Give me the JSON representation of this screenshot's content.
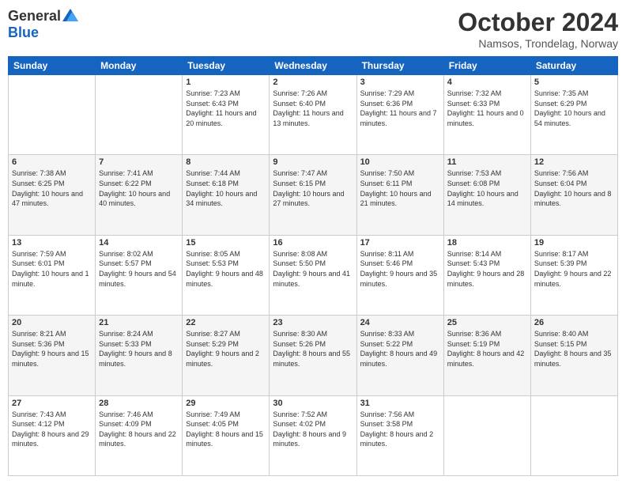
{
  "logo": {
    "general": "General",
    "blue": "Blue"
  },
  "header": {
    "month": "October 2024",
    "location": "Namsos, Trondelag, Norway"
  },
  "weekdays": [
    "Sunday",
    "Monday",
    "Tuesday",
    "Wednesday",
    "Thursday",
    "Friday",
    "Saturday"
  ],
  "weeks": [
    [
      {
        "day": "",
        "sunrise": "",
        "sunset": "",
        "daylight": ""
      },
      {
        "day": "",
        "sunrise": "",
        "sunset": "",
        "daylight": ""
      },
      {
        "day": "1",
        "sunrise": "Sunrise: 7:23 AM",
        "sunset": "Sunset: 6:43 PM",
        "daylight": "Daylight: 11 hours and 20 minutes."
      },
      {
        "day": "2",
        "sunrise": "Sunrise: 7:26 AM",
        "sunset": "Sunset: 6:40 PM",
        "daylight": "Daylight: 11 hours and 13 minutes."
      },
      {
        "day": "3",
        "sunrise": "Sunrise: 7:29 AM",
        "sunset": "Sunset: 6:36 PM",
        "daylight": "Daylight: 11 hours and 7 minutes."
      },
      {
        "day": "4",
        "sunrise": "Sunrise: 7:32 AM",
        "sunset": "Sunset: 6:33 PM",
        "daylight": "Daylight: 11 hours and 0 minutes."
      },
      {
        "day": "5",
        "sunrise": "Sunrise: 7:35 AM",
        "sunset": "Sunset: 6:29 PM",
        "daylight": "Daylight: 10 hours and 54 minutes."
      }
    ],
    [
      {
        "day": "6",
        "sunrise": "Sunrise: 7:38 AM",
        "sunset": "Sunset: 6:25 PM",
        "daylight": "Daylight: 10 hours and 47 minutes."
      },
      {
        "day": "7",
        "sunrise": "Sunrise: 7:41 AM",
        "sunset": "Sunset: 6:22 PM",
        "daylight": "Daylight: 10 hours and 40 minutes."
      },
      {
        "day": "8",
        "sunrise": "Sunrise: 7:44 AM",
        "sunset": "Sunset: 6:18 PM",
        "daylight": "Daylight: 10 hours and 34 minutes."
      },
      {
        "day": "9",
        "sunrise": "Sunrise: 7:47 AM",
        "sunset": "Sunset: 6:15 PM",
        "daylight": "Daylight: 10 hours and 27 minutes."
      },
      {
        "day": "10",
        "sunrise": "Sunrise: 7:50 AM",
        "sunset": "Sunset: 6:11 PM",
        "daylight": "Daylight: 10 hours and 21 minutes."
      },
      {
        "day": "11",
        "sunrise": "Sunrise: 7:53 AM",
        "sunset": "Sunset: 6:08 PM",
        "daylight": "Daylight: 10 hours and 14 minutes."
      },
      {
        "day": "12",
        "sunrise": "Sunrise: 7:56 AM",
        "sunset": "Sunset: 6:04 PM",
        "daylight": "Daylight: 10 hours and 8 minutes."
      }
    ],
    [
      {
        "day": "13",
        "sunrise": "Sunrise: 7:59 AM",
        "sunset": "Sunset: 6:01 PM",
        "daylight": "Daylight: 10 hours and 1 minute."
      },
      {
        "day": "14",
        "sunrise": "Sunrise: 8:02 AM",
        "sunset": "Sunset: 5:57 PM",
        "daylight": "Daylight: 9 hours and 54 minutes."
      },
      {
        "day": "15",
        "sunrise": "Sunrise: 8:05 AM",
        "sunset": "Sunset: 5:53 PM",
        "daylight": "Daylight: 9 hours and 48 minutes."
      },
      {
        "day": "16",
        "sunrise": "Sunrise: 8:08 AM",
        "sunset": "Sunset: 5:50 PM",
        "daylight": "Daylight: 9 hours and 41 minutes."
      },
      {
        "day": "17",
        "sunrise": "Sunrise: 8:11 AM",
        "sunset": "Sunset: 5:46 PM",
        "daylight": "Daylight: 9 hours and 35 minutes."
      },
      {
        "day": "18",
        "sunrise": "Sunrise: 8:14 AM",
        "sunset": "Sunset: 5:43 PM",
        "daylight": "Daylight: 9 hours and 28 minutes."
      },
      {
        "day": "19",
        "sunrise": "Sunrise: 8:17 AM",
        "sunset": "Sunset: 5:39 PM",
        "daylight": "Daylight: 9 hours and 22 minutes."
      }
    ],
    [
      {
        "day": "20",
        "sunrise": "Sunrise: 8:21 AM",
        "sunset": "Sunset: 5:36 PM",
        "daylight": "Daylight: 9 hours and 15 minutes."
      },
      {
        "day": "21",
        "sunrise": "Sunrise: 8:24 AM",
        "sunset": "Sunset: 5:33 PM",
        "daylight": "Daylight: 9 hours and 8 minutes."
      },
      {
        "day": "22",
        "sunrise": "Sunrise: 8:27 AM",
        "sunset": "Sunset: 5:29 PM",
        "daylight": "Daylight: 9 hours and 2 minutes."
      },
      {
        "day": "23",
        "sunrise": "Sunrise: 8:30 AM",
        "sunset": "Sunset: 5:26 PM",
        "daylight": "Daylight: 8 hours and 55 minutes."
      },
      {
        "day": "24",
        "sunrise": "Sunrise: 8:33 AM",
        "sunset": "Sunset: 5:22 PM",
        "daylight": "Daylight: 8 hours and 49 minutes."
      },
      {
        "day": "25",
        "sunrise": "Sunrise: 8:36 AM",
        "sunset": "Sunset: 5:19 PM",
        "daylight": "Daylight: 8 hours and 42 minutes."
      },
      {
        "day": "26",
        "sunrise": "Sunrise: 8:40 AM",
        "sunset": "Sunset: 5:15 PM",
        "daylight": "Daylight: 8 hours and 35 minutes."
      }
    ],
    [
      {
        "day": "27",
        "sunrise": "Sunrise: 7:43 AM",
        "sunset": "Sunset: 4:12 PM",
        "daylight": "Daylight: 8 hours and 29 minutes."
      },
      {
        "day": "28",
        "sunrise": "Sunrise: 7:46 AM",
        "sunset": "Sunset: 4:09 PM",
        "daylight": "Daylight: 8 hours and 22 minutes."
      },
      {
        "day": "29",
        "sunrise": "Sunrise: 7:49 AM",
        "sunset": "Sunset: 4:05 PM",
        "daylight": "Daylight: 8 hours and 15 minutes."
      },
      {
        "day": "30",
        "sunrise": "Sunrise: 7:52 AM",
        "sunset": "Sunset: 4:02 PM",
        "daylight": "Daylight: 8 hours and 9 minutes."
      },
      {
        "day": "31",
        "sunrise": "Sunrise: 7:56 AM",
        "sunset": "Sunset: 3:58 PM",
        "daylight": "Daylight: 8 hours and 2 minutes."
      },
      {
        "day": "",
        "sunrise": "",
        "sunset": "",
        "daylight": ""
      },
      {
        "day": "",
        "sunrise": "",
        "sunset": "",
        "daylight": ""
      }
    ]
  ]
}
